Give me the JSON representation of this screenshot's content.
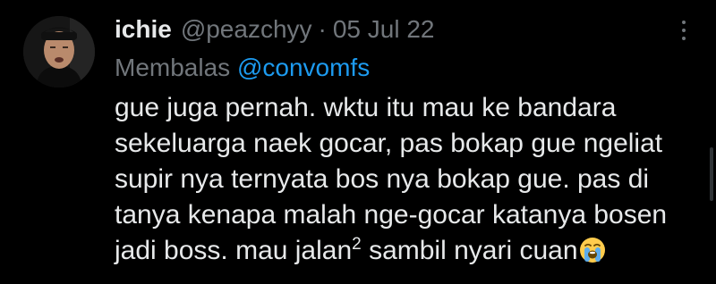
{
  "tweet": {
    "display_name": "ichie",
    "handle": "@peazchyy",
    "separator": "·",
    "date": "05 Jul 22",
    "reply_label": "Membalas",
    "reply_to": "@convomfs",
    "body_lines": [
      "gue juga pernah. wktu itu mau ke bandara",
      "sekeluarga naek gocar, pas bokap gue ngeliat",
      "supir nya ternyata bos nya bokap gue. pas di",
      "tanya kenapa malah nge-gocar katanya bosen"
    ],
    "last_line": {
      "before": "jadi boss. mau jalan",
      "superscript": "2",
      "after": " sambil nyari cuan"
    },
    "emoji": "loudly-crying-face-emoji"
  },
  "icons": {
    "more": "more-options-icon"
  },
  "colors": {
    "background": "#000000",
    "text": "#e7e9ea",
    "muted": "#71767b",
    "link": "#1d9bf0"
  }
}
